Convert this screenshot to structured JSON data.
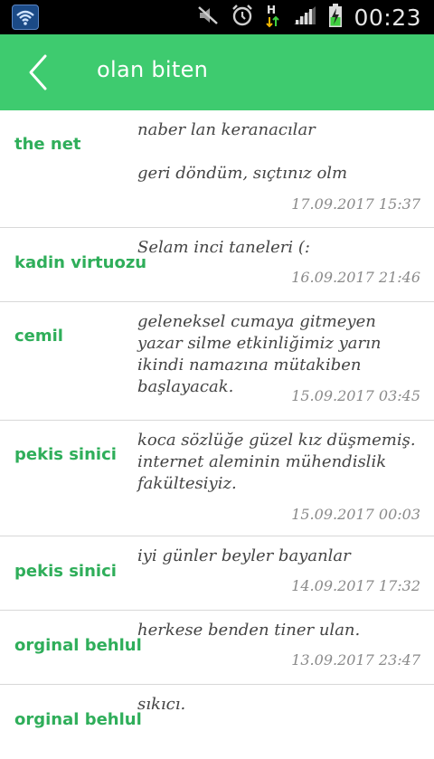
{
  "status_bar": {
    "time": "00:23",
    "icons": [
      "wifi-app-icon",
      "mute-icon",
      "alarm-icon",
      "h-data-icon",
      "signal-icon",
      "battery-charging-icon"
    ]
  },
  "header": {
    "title": "olan biten",
    "back_icon": "chevron-left-icon"
  },
  "colors": {
    "accent": "#3ecb6f",
    "author": "#2fae5a"
  },
  "messages": [
    {
      "author": "the net",
      "text": "naber lan keranacılar\n\ngeri döndüm, sıçtınız olm",
      "date": "17.09.2017 15:37"
    },
    {
      "author": "kadin virtuozu",
      "text": "Selam inci taneleri (:",
      "date": "16.09.2017 21:46"
    },
    {
      "author": "cemil",
      "text": "geleneksel cumaya gitmeyen yazar silme etkinliğimiz yarın ikindi namazına mütakiben başlayacak.",
      "date": "15.09.2017 03:45"
    },
    {
      "author": "pekis sinici",
      "text": "koca sözlüğe güzel kız düşmemiş. internet aleminin mühendislik fakültesiyiz.",
      "date": "15.09.2017 00:03"
    },
    {
      "author": "pekis sinici",
      "text": "iyi günler beyler bayanlar",
      "date": "14.09.2017 17:32"
    },
    {
      "author": "orginal behlul",
      "text": "herkese benden tiner ulan.",
      "date": "13.09.2017 23:47"
    },
    {
      "author": "orginal behlul",
      "text": "sıkıcı.",
      "date": ""
    }
  ]
}
